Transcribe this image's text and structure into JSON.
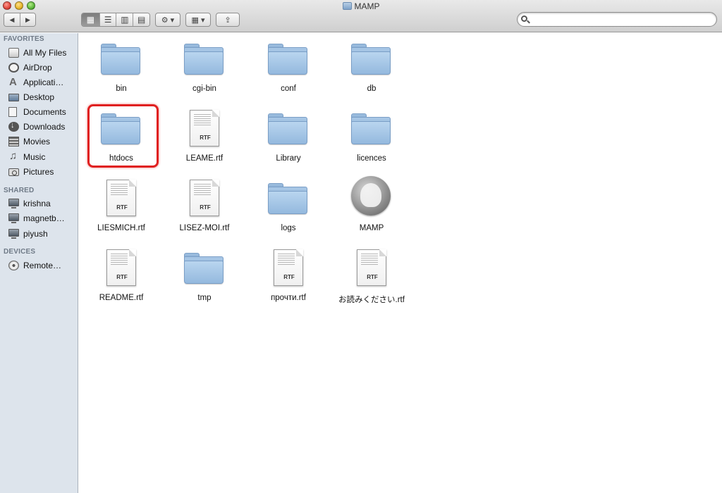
{
  "window": {
    "title": "MAMP"
  },
  "toolbar": {
    "back_label": "◀",
    "forward_label": "▶",
    "view_icons_label": "▦",
    "view_list_label": "☰",
    "view_columns_label": "▥",
    "view_coverflow_label": "▤",
    "action_label": "⚙ ▾",
    "arrange_label": "▦ ▾",
    "share_label": "⇪"
  },
  "search": {
    "value": "",
    "placeholder": ""
  },
  "sidebar": {
    "favorites_header": "FAVORITES",
    "favorites": [
      {
        "label": "All My Files",
        "icon": "all-files-icon"
      },
      {
        "label": "AirDrop",
        "icon": "airdrop-icon"
      },
      {
        "label": "Applicati…",
        "icon": "applications-icon"
      },
      {
        "label": "Desktop",
        "icon": "desktop-icon"
      },
      {
        "label": "Documents",
        "icon": "documents-icon"
      },
      {
        "label": "Downloads",
        "icon": "downloads-icon"
      },
      {
        "label": "Movies",
        "icon": "movies-icon"
      },
      {
        "label": "Music",
        "icon": "music-icon"
      },
      {
        "label": "Pictures",
        "icon": "pictures-icon"
      }
    ],
    "shared_header": "SHARED",
    "shared": [
      {
        "label": "krishna",
        "icon": "computer-icon"
      },
      {
        "label": "magnetb…",
        "icon": "computer-icon"
      },
      {
        "label": "piyush",
        "icon": "computer-icon"
      }
    ],
    "devices_header": "DEVICES",
    "devices": [
      {
        "label": "Remote…",
        "icon": "remote-disc-icon"
      }
    ]
  },
  "files": [
    {
      "name": "bin",
      "kind": "folder"
    },
    {
      "name": "cgi-bin",
      "kind": "folder"
    },
    {
      "name": "conf",
      "kind": "folder"
    },
    {
      "name": "db",
      "kind": "folder"
    },
    {
      "name": "htdocs",
      "kind": "folder"
    },
    {
      "name": "LEAME.rtf",
      "kind": "rtf",
      "badge": "RTF"
    },
    {
      "name": "Library",
      "kind": "folder"
    },
    {
      "name": "licences",
      "kind": "folder"
    },
    {
      "name": "LIESMICH.rtf",
      "kind": "rtf",
      "badge": "RTF"
    },
    {
      "name": "LISEZ-MOI.rtf",
      "kind": "rtf",
      "badge": "RTF"
    },
    {
      "name": "logs",
      "kind": "folder"
    },
    {
      "name": "MAMP",
      "kind": "app"
    },
    {
      "name": "README.rtf",
      "kind": "rtf",
      "badge": "RTF"
    },
    {
      "name": "tmp",
      "kind": "folder"
    },
    {
      "name": "прочти.rtf",
      "kind": "rtf",
      "badge": "RTF"
    },
    {
      "name": "お読みください.rtf",
      "kind": "rtf",
      "badge": "RTF"
    }
  ],
  "colors": {
    "highlight": "#e02020",
    "sidebar_bg": "#dde4ec",
    "folder_blue": "#94b9de"
  }
}
